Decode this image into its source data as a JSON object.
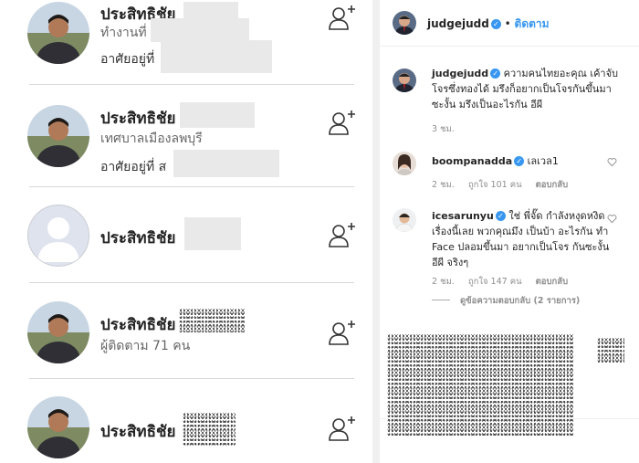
{
  "left": {
    "people": [
      {
        "name": "ประสิทธิชัย",
        "line1": "ทำงานที่",
        "line2": "อาศัยอยู่ที่"
      },
      {
        "name": "ประสิทธิชัย",
        "line1": "เทศบาลเมืองลพบุรี",
        "line2": "อาศัยอยู่ที่ ส"
      },
      {
        "name": "ประสิทธิชัย",
        "line1": "",
        "line2": ""
      },
      {
        "name": "ประสิทธิชัย",
        "line1": "ผู้ติดตาม 71 คน",
        "line2": ""
      },
      {
        "name": "ประสิทธิชัย",
        "line1": "",
        "line2": ""
      }
    ],
    "add_friend_icon": "add-person-icon"
  },
  "post": {
    "header": {
      "username": "judgejudd",
      "dot": "•",
      "follow_label": "ติดตาม"
    },
    "caption": {
      "username": "judgejudd",
      "text": "ความคนไทยอะคุณ เค้าจับโจรซึ่งทองได้ มรึงก็อยากเป็นโจรกันขึ้นมาซะงั้น มรึงเป็นอะไรกัน อีผี",
      "time": "3 ชม."
    },
    "comments": [
      {
        "username": "boompanadda",
        "text": "เลเวล1",
        "time": "2 ชม.",
        "likes": "ถูกใจ 101 คน",
        "reply": "ตอบกลับ"
      },
      {
        "username": "icesarunyu",
        "text": "ใช่ พี่จั๊ด กำลังหงุดหงิด เรื่องนี้เลย พวกคุณมึง เป็นบ้า อะไรกัน ทำ Face ปลอมขึ้นมา อยากเป็นโจร กันซะงั้น อีผี จริงๆ",
        "time": "2 ชม.",
        "likes": "ถูกใจ 147 คน",
        "reply": "ตอบกลับ"
      }
    ],
    "view_replies": "ดูข้อความตอบกลับ (2 รายการ)"
  },
  "colors": {
    "link_blue": "#3897f0",
    "border": "#dbdbdb",
    "muted": "#8e8e8e"
  }
}
